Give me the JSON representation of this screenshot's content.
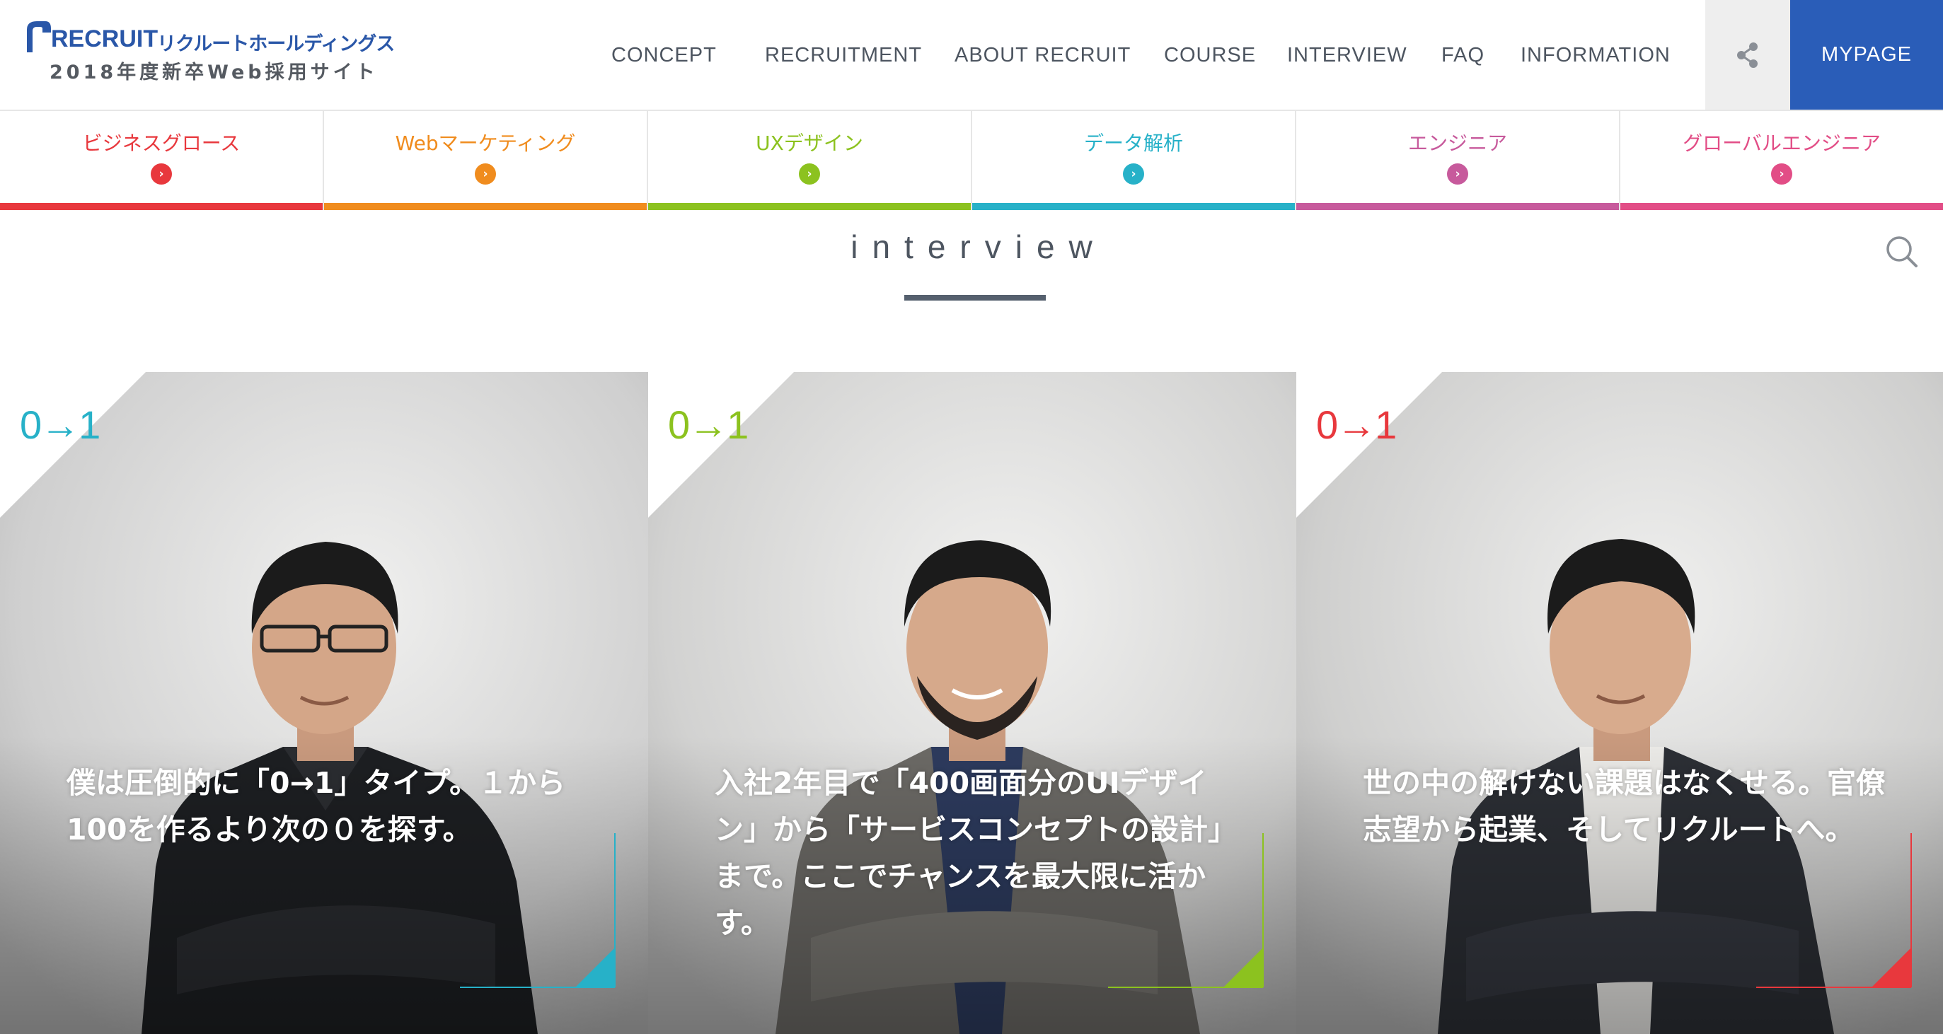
{
  "header": {
    "logo_brand": "RECRUIT",
    "logo_brand_jp": "リクルートホールディングス",
    "logo_sub": "2018年度新卒Web採用サイト",
    "nav": [
      {
        "label": "CONCEPT"
      },
      {
        "label": "RECRUITMENT"
      },
      {
        "label": "ABOUT RECRUIT"
      },
      {
        "label": "COURSE"
      },
      {
        "label": "INTERVIEW"
      },
      {
        "label": "FAQ"
      },
      {
        "label": "INFORMATION"
      }
    ],
    "mypage_label": "MYPAGE"
  },
  "categories": [
    {
      "label": "ビジネスグロース",
      "color": "#e8383d"
    },
    {
      "label": "Webマーケティング",
      "color": "#f08c1e"
    },
    {
      "label": "UXデザイン",
      "color": "#8cc21f"
    },
    {
      "label": "データ解析",
      "color": "#27b1c8"
    },
    {
      "label": "エンジニア",
      "color": "#c75a9c"
    },
    {
      "label": "グローバルエンジニア",
      "color": "#e24d86"
    }
  ],
  "section": {
    "title": "interview"
  },
  "cards": [
    {
      "badge": "0→1",
      "accent": "#27b1c8",
      "text": "僕は圧倒的に「0→1」タイプ。１から100を作るより次の０を探す。"
    },
    {
      "badge": "0→1",
      "accent": "#8cc21f",
      "text": "入社2年目で「400画面分のUIデザイン」から「サービスコンセプトの設計」まで。ここでチャンスを最大限に活かす。"
    },
    {
      "badge": "0→1",
      "accent": "#e8383d",
      "text": "世の中の解けない課題はなくせる。官僚志望から起業、そしてリクルートへ。"
    }
  ],
  "icons": {
    "share": "share-icon",
    "search": "search-icon",
    "arrow": "chevron-right-icon"
  }
}
